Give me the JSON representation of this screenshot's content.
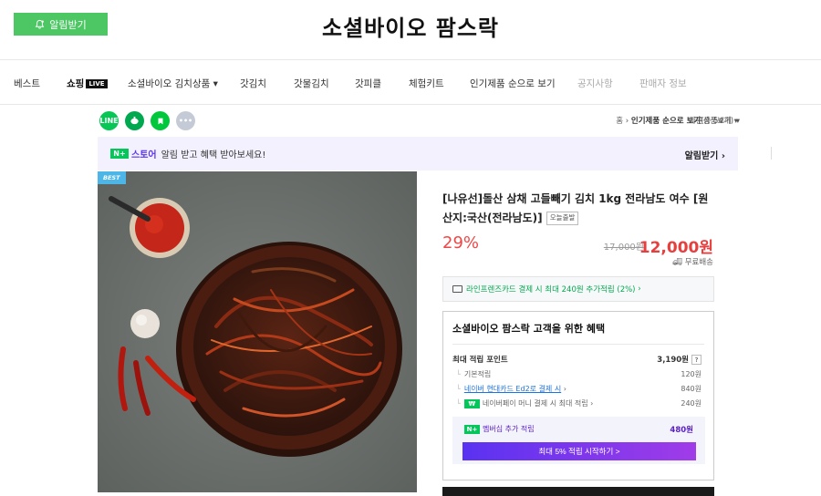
{
  "header": {
    "alarm_button": "알림받기",
    "store_title": "소셜바이오 팜스락"
  },
  "nav": {
    "items": [
      "베스트",
      "쇼핑",
      "소셜바이오 김치상품",
      "갓김치",
      "갓물김치",
      "갓피클",
      "체험키트",
      "인기제품 순으로 보기",
      "공지사항",
      "판매자 정보"
    ],
    "live_tag": "LIVE",
    "dropdown_arrow": "▾"
  },
  "share": {
    "icons": [
      "line-icon",
      "kakaostory-icon",
      "band-icon",
      "more-icon"
    ],
    "labels": [
      "LINE",
      "•",
      "▶",
      "•••"
    ],
    "colors": [
      "#06c755",
      "#00a84f",
      "#00c73c",
      "#c5cbd6"
    ]
  },
  "breadcrumb": {
    "home": "홈",
    "current": "인기제품 순으로 보기",
    "count": "(총 54개)",
    "other": "다른상품보기"
  },
  "banner": {
    "store_brand": "스토어",
    "text": "알림 받고 혜택 받아보세요!",
    "action": "알림받기"
  },
  "npay_mark": "N+",
  "image": {
    "badge": "BEST"
  },
  "product": {
    "title": "[나유선]돌산 삼채 고들빼기 김치 1kg 전라남도 여수 [원산지:국산(전라남도)]",
    "badge": "오늘출발",
    "discount": "29%",
    "original_price": "17,000원",
    "price": "12,000원",
    "shipping": "무료배송",
    "card_offer": "라인프렌즈카드 결제 시 최대 240원 추가적립 (2%)"
  },
  "benefits": {
    "title": "소셜바이오 팜스락 고객을 위한 혜택",
    "max_points_label": "최대 적립 포인트",
    "max_points_value": "3,190원",
    "help": "?",
    "rows": [
      {
        "label": "기본적립",
        "value": "120원"
      },
      {
        "label": "네이버 현대카드 Ed2로 결제 시",
        "value": "840원"
      },
      {
        "label": "네이버페이 머니 결제 시 최대 적립",
        "value": "240원"
      }
    ],
    "member_label": "멤버십 추가 적립",
    "member_value": "480원",
    "member_button": "최대 5% 적립 시작하기 >"
  },
  "colors": {
    "accent_green": "#4cc764",
    "price_red": "#e73e3e",
    "naver_green": "#03c75a",
    "membership_purple": "#5a32f1"
  }
}
